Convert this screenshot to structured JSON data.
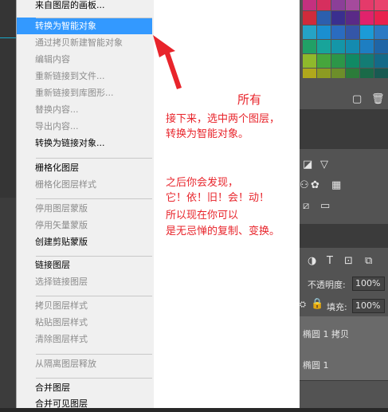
{
  "menu": {
    "items": [
      {
        "label": "来自图层的画板...",
        "disabled": false,
        "highlighted": false
      },
      {
        "label": "转换为智能对象",
        "disabled": false,
        "highlighted": true
      },
      {
        "label": "通过拷贝新建智能对象",
        "disabled": true,
        "highlighted": false
      },
      {
        "label": "编辑内容",
        "disabled": true,
        "highlighted": false
      },
      {
        "label": "重新链接到文件...",
        "disabled": true,
        "highlighted": false
      },
      {
        "label": "重新链接到库图形...",
        "disabled": true,
        "highlighted": false
      },
      {
        "label": "替换内容...",
        "disabled": true,
        "highlighted": false
      },
      {
        "label": "导出内容...",
        "disabled": true,
        "highlighted": false
      },
      {
        "label": "转换为链接对象...",
        "disabled": false,
        "highlighted": false
      },
      {
        "label": "栅格化图层",
        "disabled": false,
        "highlighted": false
      },
      {
        "label": "栅格化图层样式",
        "disabled": true,
        "highlighted": false
      },
      {
        "label": "停用图层蒙版",
        "disabled": true,
        "highlighted": false
      },
      {
        "label": "停用矢量蒙版",
        "disabled": true,
        "highlighted": false
      },
      {
        "label": "创建剪贴蒙版",
        "disabled": false,
        "highlighted": false
      },
      {
        "label": "链接图层",
        "disabled": false,
        "highlighted": false
      },
      {
        "label": "选择链接图层",
        "disabled": true,
        "highlighted": false
      },
      {
        "label": "拷贝图层样式",
        "disabled": true,
        "highlighted": false
      },
      {
        "label": "粘贴图层样式",
        "disabled": true,
        "highlighted": false
      },
      {
        "label": "清除图层样式",
        "disabled": true,
        "highlighted": false
      },
      {
        "label": "从隔离图层释放",
        "disabled": true,
        "highlighted": false
      },
      {
        "label": "合并图层",
        "disabled": false,
        "highlighted": false
      },
      {
        "label": "合并可见图层",
        "disabled": false,
        "highlighted": false
      }
    ]
  },
  "annotation": {
    "title": "所有",
    "line1": "接下来，选中两个图层，",
    "line2": "转换为智能对象。",
    "line3": "之后你会发现，",
    "line4": "它！依！旧！会！动！",
    "line5": "所以现在你可以",
    "line6": "是无忌惮的复制、变换。",
    "color": "#e8242b"
  },
  "layers_panel": {
    "opacity_label": "不透明度:",
    "opacity_value": "100%",
    "fill_label": "填充:",
    "fill_value": "100%",
    "layers": [
      "椭圆 1 拷贝",
      "椭圆 1"
    ]
  },
  "swatches": {
    "colors": [
      "#c4307f",
      "#d62f5e",
      "#8b3f98",
      "#a54a9c",
      "#e43a6a",
      "#e8426d",
      "#cf2b3b",
      "#2c5fae",
      "#3a2f8f",
      "#5a2a87",
      "#e0226c",
      "#e9214e",
      "#25a3c6",
      "#1a8fd0",
      "#2a6cc0",
      "#3456a8",
      "#1b9bd7",
      "#2c7ac4",
      "#21a066",
      "#18a49a",
      "#1496a8",
      "#148bb0",
      "#1d7ec2",
      "#1f65a6",
      "#8fb92c",
      "#46a63c",
      "#2c9648",
      "#108a64",
      "#137c74",
      "#146a88",
      "#b0a81c",
      "#8c9b22",
      "#6d8e2a",
      "#2c7c3a",
      "#1a6a48",
      "#185a52",
      "#7a2e2e",
      "#a03a3a",
      "#c8a880",
      "#a08c70",
      "#80704e",
      "#5c4a3a"
    ]
  }
}
